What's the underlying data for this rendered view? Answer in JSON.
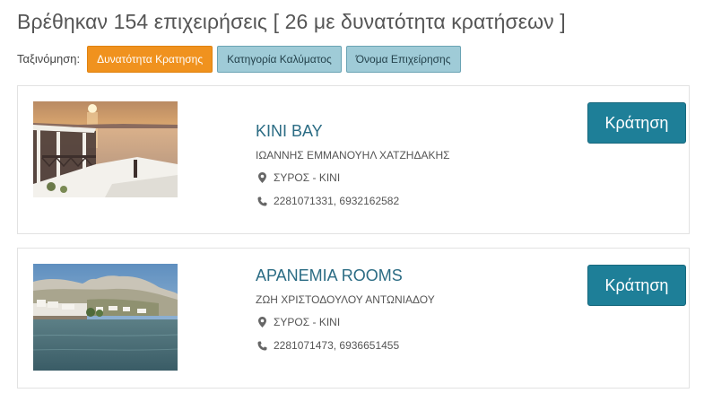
{
  "header": {
    "results_title": "Βρέθηκαν 154 επιχειρήσεις [ 26 με δυνατότητα κρατήσεων ]"
  },
  "sort": {
    "label": "Ταξινόμηση:",
    "options": [
      "Δυνατότητα Κρατησης",
      "Κατηγορία Καλύματος",
      "Όνομα Επιχείρησης"
    ],
    "active_index": 0
  },
  "listings": [
    {
      "name": "KINI BAY",
      "owner": "ΙΩΑΝΝΗΣ ΕΜΜΑΝΟΥΗΛ ΧΑΤΖΗΔΑΚΗΣ",
      "location": "ΣΥΡΟΣ - ΚΙΝΙ",
      "phone": "2281071331, 6932162582",
      "book_label": "Κράτηση",
      "location_icon": "map-marker-icon",
      "phone_icon": "phone-icon"
    },
    {
      "name": "ΑΡΑΝΕΜΙΑ ROOMS",
      "owner": "ΖΩΗ ΧΡΙΣΤΟΔΟΥΛΟΥ ΑΝΤΩΝΙΑΔΟΥ",
      "location": "ΣΥΡΟΣ - ΚΙΝΙ",
      "phone": "2281071473, 6936651455",
      "book_label": "Κράτηση",
      "location_icon": "map-marker-icon",
      "phone_icon": "phone-icon"
    }
  ],
  "colors": {
    "accent_orange": "#f0921e",
    "sort_button": "#9fcbd7",
    "book_button": "#1e7f98",
    "link": "#2b6c84"
  }
}
